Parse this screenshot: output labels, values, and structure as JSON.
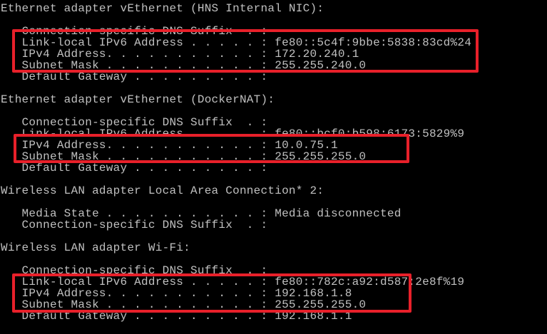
{
  "highlight_color": "#e8202a",
  "text_color": "#c0c0c0",
  "background_color": "#000000",
  "lines": [
    "Ethernet adapter vEthernet (HNS Internal NIC):",
    "",
    "   Connection-specific DNS Suffix  . :",
    "   Link-local IPv6 Address . . . . . : fe80::5c4f:9bbe:5838:83cd%24",
    "   IPv4 Address. . . . . . . . . . . : 172.20.240.1",
    "   Subnet Mask . . . . . . . . . . . : 255.255.240.0",
    "   Default Gateway . . . . . . . . . :",
    "",
    "Ethernet adapter vEthernet (DockerNAT):",
    "",
    "   Connection-specific DNS Suffix  . :",
    "   Link-local IPv6 Address . . . . . : fe80::bcf0:b598:6173:5829%9",
    "   IPv4 Address. . . . . . . . . . . : 10.0.75.1",
    "   Subnet Mask . . . . . . . . . . . : 255.255.255.0",
    "   Default Gateway . . . . . . . . . :",
    "",
    "Wireless LAN adapter Local Area Connection* 2:",
    "",
    "   Media State . . . . . . . . . . . : Media disconnected",
    "   Connection-specific DNS Suffix  . :",
    "",
    "Wireless LAN adapter Wi-Fi:",
    "",
    "   Connection-specific DNS Suffix  . :",
    "   Link-local IPv6 Address . . . . . : fe80::782c:a92:d587:2e8f%19",
    "   IPv4 Address. . . . . . . . . . . : 192.168.1.8",
    "   Subnet Mask . . . . . . . . . . . : 255.255.255.0",
    "   Default Gateway . . . . . . . . . : 192.168.1.1"
  ]
}
